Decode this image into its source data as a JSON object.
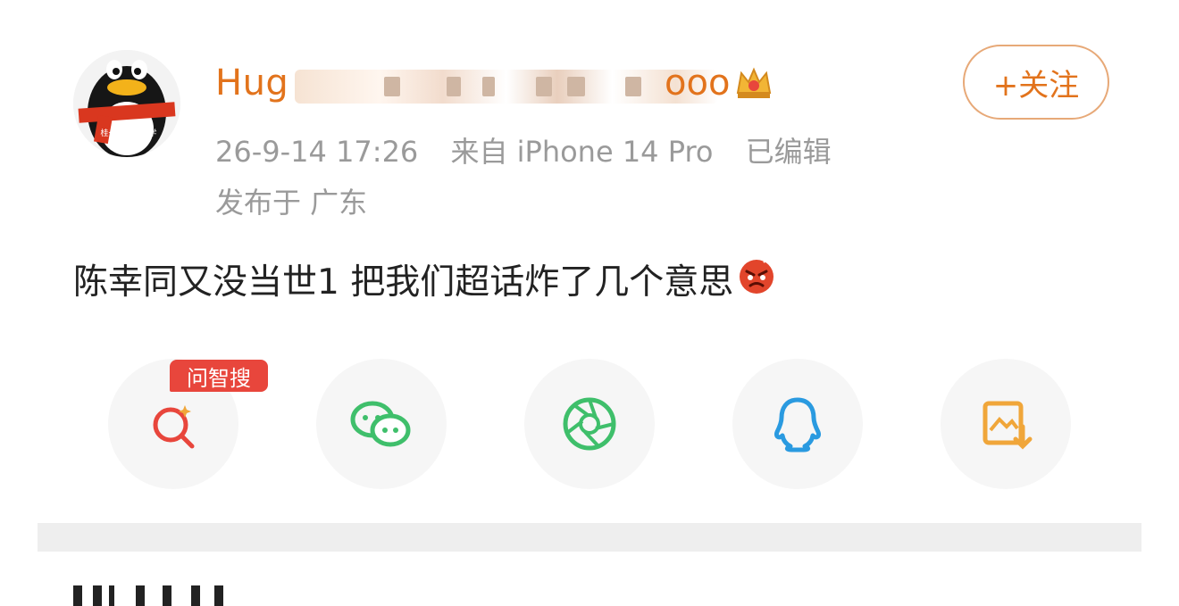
{
  "post": {
    "username": "Hug",
    "username_tail": "ooo",
    "follow_label": "+关注",
    "timestamp": "26-9-14 17:26",
    "source": "来自 iPhone 14 Pro",
    "edited": "已编辑",
    "location": "发布于 广东",
    "content": "陈幸同又没当世1 把我们超话炸了几个意思"
  },
  "share": {
    "ai_search_badge": "问智搜",
    "items": [
      {
        "icon": "ai-search-icon",
        "color": "#e8463c"
      },
      {
        "icon": "wechat-icon",
        "color": "#3fbf6b"
      },
      {
        "icon": "moments-icon",
        "color": "#3fbf6b"
      },
      {
        "icon": "qq-icon",
        "color": "#2a9ae0"
      },
      {
        "icon": "save-image-icon",
        "color": "#f0a63a"
      }
    ]
  },
  "colors": {
    "accent": "#e2731c",
    "meta_gray": "#9a9a9a",
    "text": "#222222",
    "divider": "#eeeeee"
  }
}
